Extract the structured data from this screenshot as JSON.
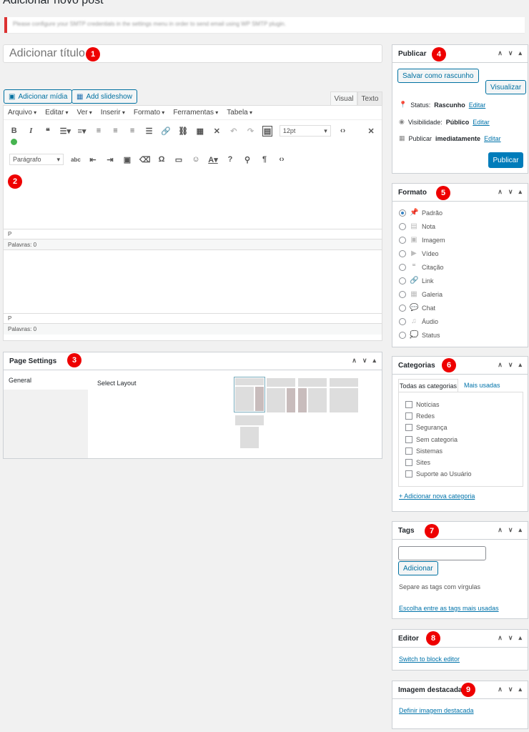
{
  "page": {
    "title": "Adicionar novo post",
    "notice": "Please configure your SMTP credentials in the settings menu in order to send email using WP SMTP plugin."
  },
  "title_field": {
    "placeholder": "Adicionar título"
  },
  "media": {
    "add_media": "Adicionar mídia",
    "add_slideshow": "Add slideshow"
  },
  "editor_tabs": {
    "visual": "Visual",
    "text": "Texto"
  },
  "menubar": [
    "Arquivo",
    "Editar",
    "Ver",
    "Inserir",
    "Formato",
    "Ferramentas",
    "Tabela"
  ],
  "toolbar": {
    "font_size": "12pt",
    "block_format": "Parágrafo"
  },
  "status": {
    "path": "P",
    "words": "Palavras: 0",
    "path2": "P",
    "words2": "Palavras: 0"
  },
  "page_settings": {
    "title": "Page Settings",
    "tab": "General",
    "select_layout": "Select Layout"
  },
  "publish": {
    "title": "Publicar",
    "save_draft": "Salvar como rascunho",
    "preview": "Visualizar",
    "status_label": "Status:",
    "status_value": "Rascunho",
    "visibility_label": "Visibilidade:",
    "visibility_value": "Público",
    "schedule_label": "Publicar",
    "schedule_value": "imediatamente",
    "edit": "Editar",
    "publish_btn": "Publicar"
  },
  "format": {
    "title": "Formato",
    "items": [
      "Padrão",
      "Nota",
      "Imagem",
      "Vídeo",
      "Citação",
      "Link",
      "Galeria",
      "Chat",
      "Áudio",
      "Status"
    ]
  },
  "categories": {
    "title": "Categorias",
    "tab_all": "Todas as categorias",
    "tab_popular": "Mais usadas",
    "items": [
      "Notícias",
      "Redes",
      "Segurança",
      "Sem categoria",
      "Sistemas",
      "Sites",
      "Suporte ao Usuário"
    ],
    "add_new": "+ Adicionar nova categoria"
  },
  "tags": {
    "title": "Tags",
    "add": "Adicionar",
    "hint": "Separe as tags com vírgulas",
    "choose": "Escolha entre as tags mais usadas"
  },
  "editor_box": {
    "title": "Editor",
    "switch": "Switch to block editor"
  },
  "featured": {
    "title": "Imagem destacada",
    "set": "Definir imagem destacada"
  },
  "badges": [
    "1",
    "2",
    "3",
    "4",
    "5",
    "6",
    "7",
    "8",
    "9"
  ]
}
